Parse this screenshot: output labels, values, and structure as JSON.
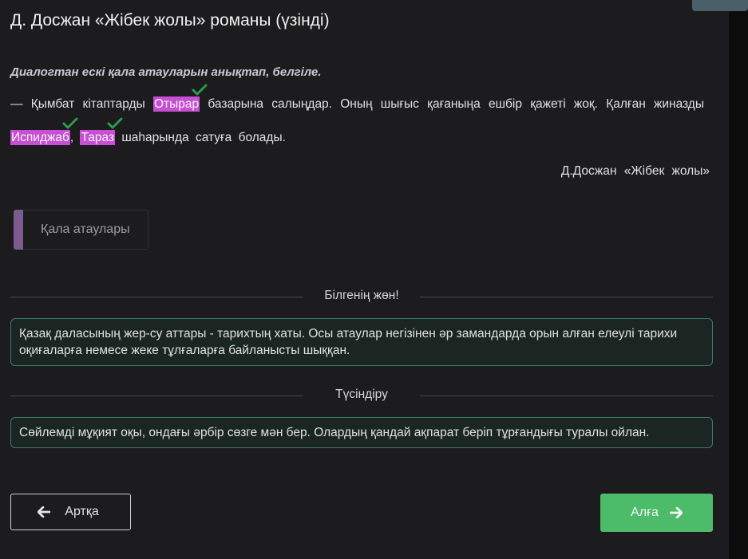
{
  "page": {
    "title": "Д. Досжан «Жібек жолы» романы (үзінді)",
    "instruction": "Диалогтан ескі қала атауларын анықтап, белгіле."
  },
  "passage": {
    "part1": "— Қымбат кітаптарды ",
    "word1": "Отырар",
    "part2": " базарына салыңдар. Оның шығыс қағаныңа ешбір қажеті жоқ. Қалған жиназды ",
    "word2": "Испиджаб",
    "part3": ", ",
    "word3": "Тараз",
    "part4": " шаһарында сатуға болады.",
    "attribution": "Д.Досжан «Жібек жолы»"
  },
  "word_bank": {
    "label": "Қала атаулары"
  },
  "sections": {
    "good_to_know_title": "Білгенің жөн!",
    "good_to_know_text": "Қазақ даласының жер-су аттары - тарихтың хаты. Осы атаулар негізінен әр замандарда орын алған елеулі тарихи оқиғаларға немесе жеке тұлғаларға байланысты шыққан.",
    "explanation_title": "Түсіндіру",
    "explanation_text": "Сөйлемді мұқият оқы, ондағы әрбір сөзге мән бер. Олардың қандай ақпарат беріп тұрғандығы туралы ойлан."
  },
  "nav": {
    "back_label": "Артқа",
    "next_label": "Алға"
  },
  "colors": {
    "highlight": "#c64fd3",
    "check": "#2f9a4a",
    "next_button": "#4cbb6a",
    "info_border": "#3b7a66"
  },
  "icons": {
    "check": "check-icon",
    "back": "arrow-left-icon",
    "next": "arrow-right-icon"
  }
}
